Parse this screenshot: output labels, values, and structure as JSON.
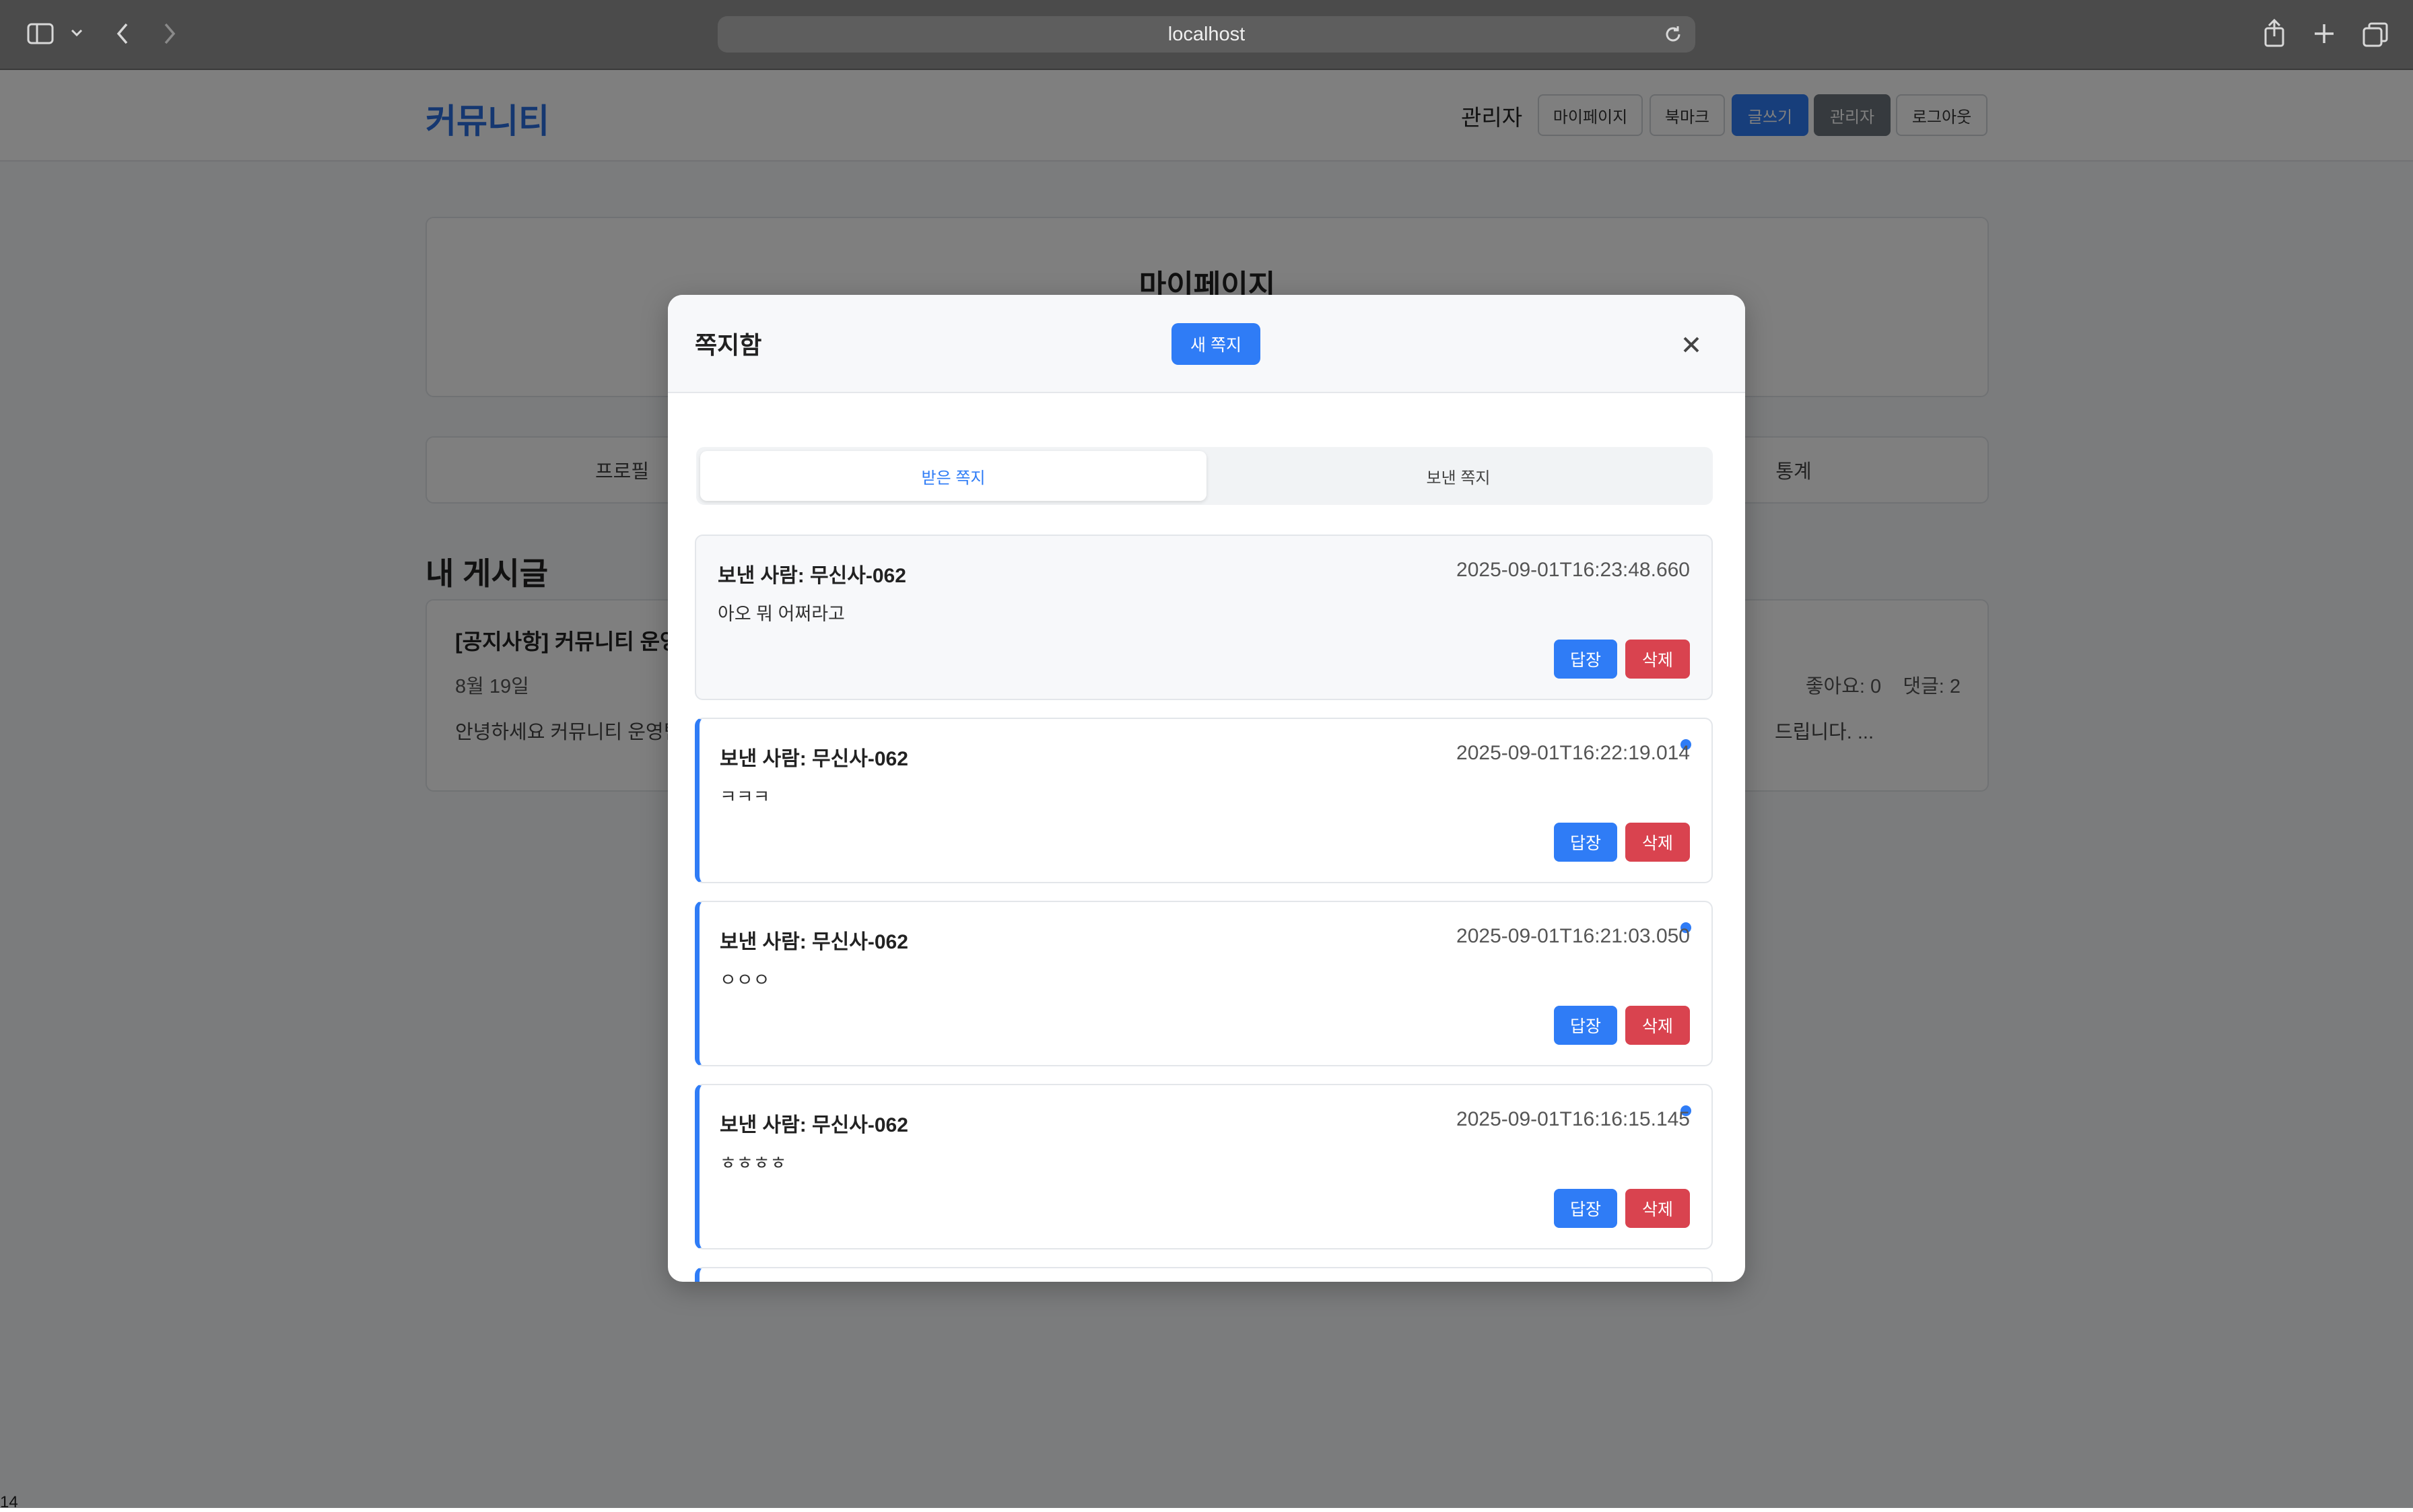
{
  "browser": {
    "url": "localhost"
  },
  "header": {
    "brand": "커뮤니티",
    "user": "관리자",
    "buttons": [
      "마이페이지",
      "북마크",
      "글쓰기",
      "관리자",
      "로그아웃"
    ]
  },
  "mypage": {
    "title": "마이페이지",
    "tabs": [
      "프로필",
      "통계"
    ],
    "section_title": "내 게시글",
    "post": {
      "title": "[공지사항] 커뮤니티 운영",
      "date": "8월 19일",
      "likes": "좋아요: 0",
      "comments": "댓글: 2",
      "excerpt_start": "안녕하세요 커뮤니티 운영팀입",
      "excerpt_end": "드립니다. ..."
    }
  },
  "corner_number": "14",
  "modal": {
    "title": "쪽지함",
    "new_button": "새 쪽지",
    "tabs": [
      "받은 쪽지",
      "보낸 쪽지"
    ],
    "reply_label": "답장",
    "delete_label": "삭제",
    "messages": [
      {
        "sender": "보낸 사람: 무신사-062",
        "time": "2025-09-01T16:23:48.660",
        "body": "아오 뭐 어쩌라고",
        "unread": false
      },
      {
        "sender": "보낸 사람: 무신사-062",
        "time": "2025-09-01T16:22:19.014",
        "body": "ㅋㅋㅋ",
        "unread": true
      },
      {
        "sender": "보낸 사람: 무신사-062",
        "time": "2025-09-01T16:21:03.050",
        "body": "ㅇㅇㅇ",
        "unread": true
      },
      {
        "sender": "보낸 사람: 무신사-062",
        "time": "2025-09-01T16:16:15.145",
        "body": "ㅎㅎㅎㅎ",
        "unread": true
      }
    ]
  },
  "colors": {
    "primary": "#2f7cf6",
    "danger": "#d9434f",
    "brand": "#2a6fe0"
  }
}
